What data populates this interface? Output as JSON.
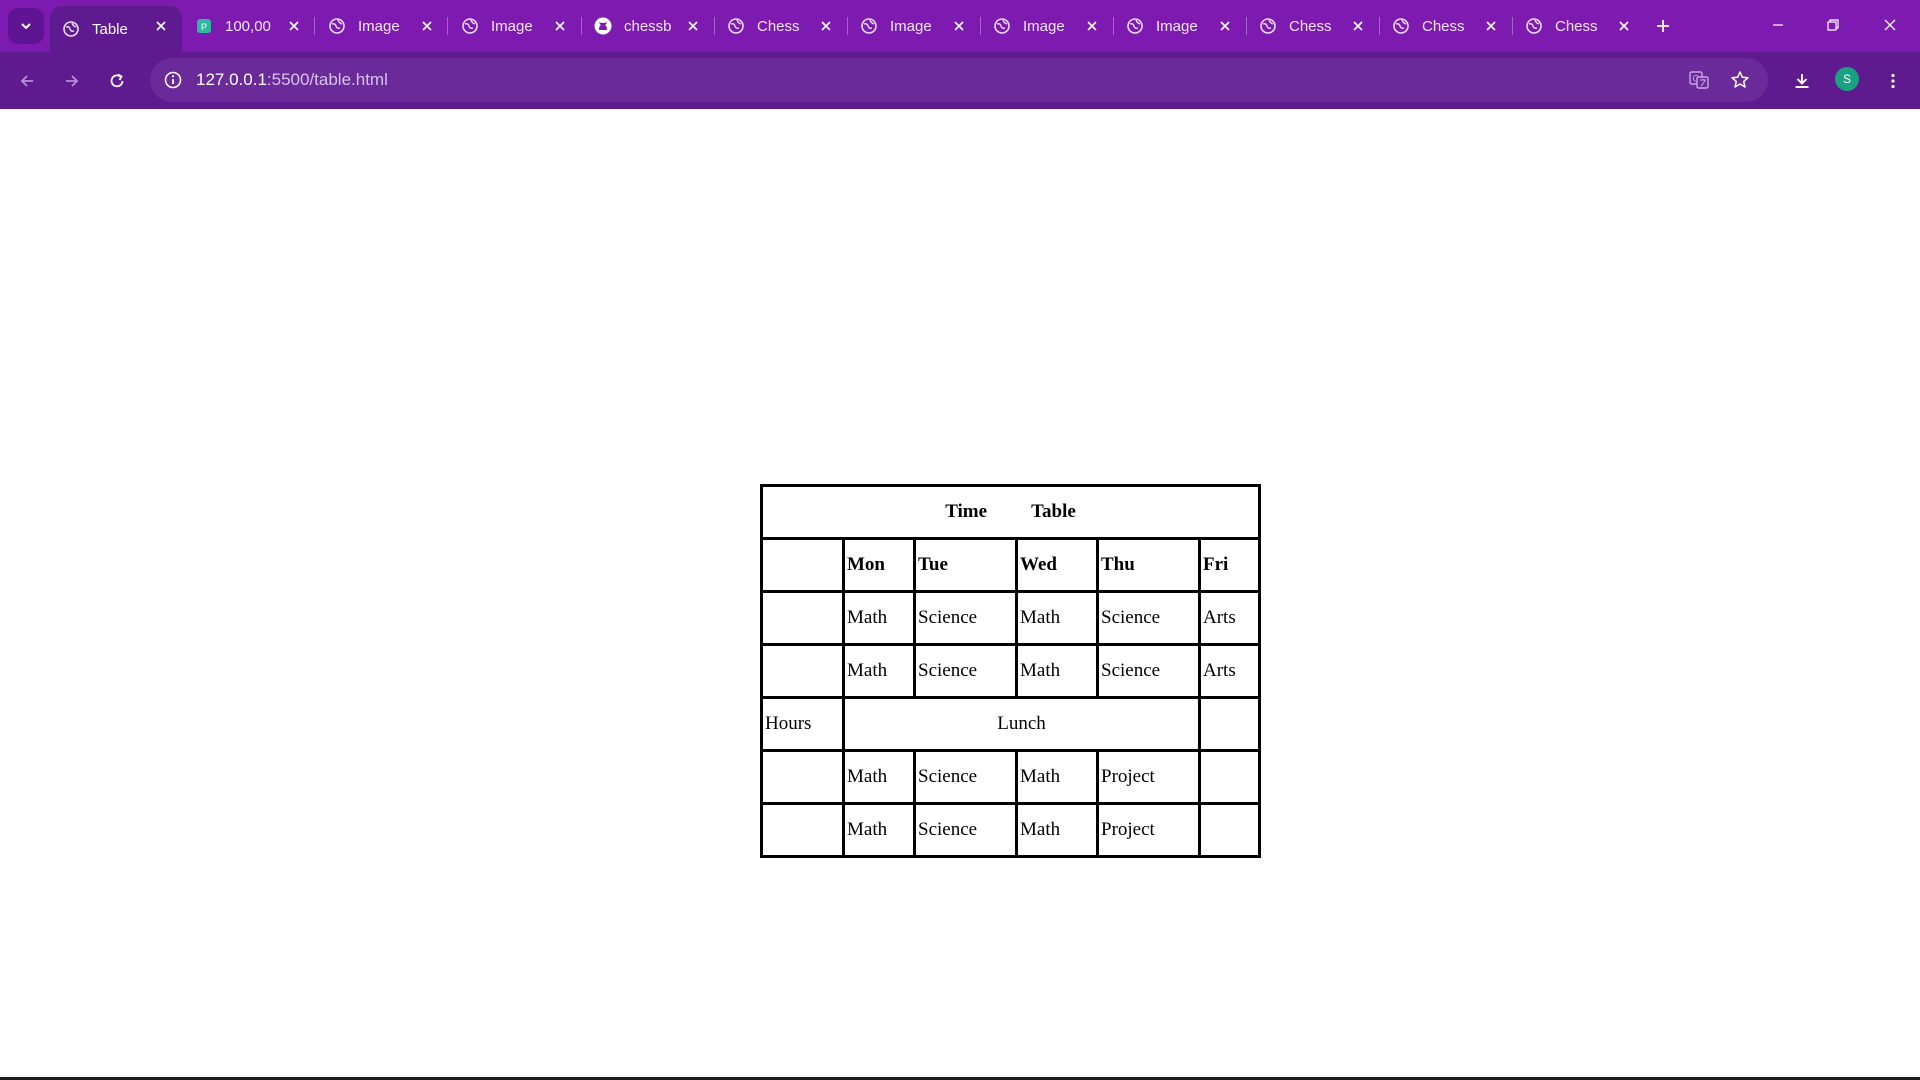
{
  "browser": {
    "tabs": [
      {
        "title": "Table",
        "icon": "globe-icon",
        "active": true
      },
      {
        "title": "100,00",
        "icon": "site-logo-icon",
        "active": false
      },
      {
        "title": "Image",
        "icon": "globe-icon",
        "active": false
      },
      {
        "title": "Image",
        "icon": "globe-icon",
        "active": false
      },
      {
        "title": "chessb",
        "icon": "github-icon",
        "active": false
      },
      {
        "title": "Chess",
        "icon": "globe-icon",
        "active": false
      },
      {
        "title": "Image",
        "icon": "globe-icon",
        "active": false
      },
      {
        "title": "Image",
        "icon": "globe-icon",
        "active": false
      },
      {
        "title": "Image",
        "icon": "globe-icon",
        "active": false
      },
      {
        "title": "Chess",
        "icon": "globe-icon",
        "active": false
      },
      {
        "title": "Chess",
        "icon": "globe-icon",
        "active": false
      },
      {
        "title": "Chess",
        "icon": "globe-icon",
        "active": false
      }
    ],
    "url_host": "127.0.0.1",
    "url_path": ":5500/table.html",
    "profile_initial": "S",
    "accent_color": "#7d1bb0",
    "toolbar_color": "#5e1a8e"
  },
  "table": {
    "caption_word_1": "Time",
    "caption_word_2": "Table",
    "headers": [
      "",
      "Mon",
      "Tue",
      "Wed",
      "Thu",
      "Fri"
    ],
    "rows": [
      [
        "",
        "Math",
        "Science",
        "Math",
        "Science",
        "Arts"
      ],
      [
        "",
        "Math",
        "Science",
        "Math",
        "Science",
        "Arts"
      ]
    ],
    "lunch_row": {
      "label": "Hours",
      "text": "Lunch",
      "last": ""
    },
    "rows_after": [
      [
        "",
        "Math",
        "Science",
        "Math",
        "Project",
        ""
      ],
      [
        "",
        "Math",
        "Science",
        "Math",
        "Project",
        ""
      ]
    ]
  }
}
